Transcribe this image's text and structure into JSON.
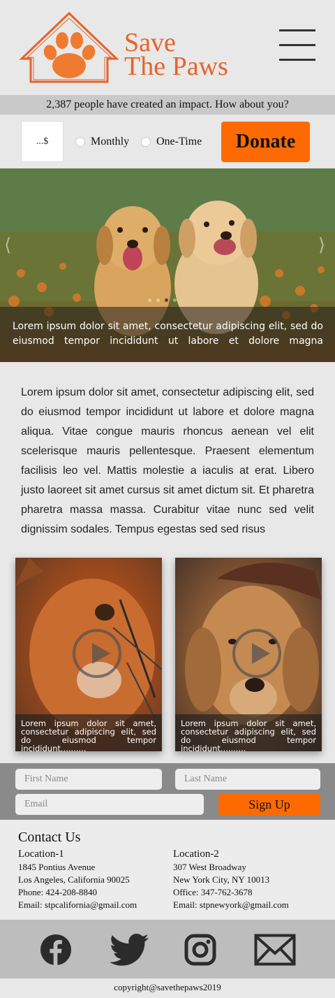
{
  "brand": {
    "line1": "Save",
    "line2": "The Paws"
  },
  "impact_text": "2,387 people have created an impact. How about you?",
  "donation": {
    "amount_placeholder": "...$",
    "options": [
      "Monthly",
      "One-Time"
    ],
    "button_label": "Donate"
  },
  "hero": {
    "caption": "Lorem ipsum dolor sit amet, consectetur adipiscing elit, sed do eiusmod tempor incididunt ut labore et dolore magna",
    "prev_arrow": "⟨",
    "next_arrow": "⟩",
    "slide_count": 4,
    "active_slide": 3
  },
  "intro_text": "Lorem ipsum dolor sit amet, consectetur adipiscing elit, sed do eiusmod tempor incididunt ut labore et dolore magna aliqua. Vitae congue mauris rhoncus aenean vel elit scelerisque mauris pellentesque. Praesent elementum facilisis leo vel. Mattis molestie a iaculis at erat. Libero justo laoreet sit amet cursus sit amet dictum sit. Et pharetra pharetra massa massa. Curabitur vitae nunc sed velit dignissim sodales. Tempus egestas sed sed risus",
  "videos": [
    {
      "caption": "Lorem ipsum dolor sit amet, consectetur adipiscing elit, sed do eiusmod tempor incididunt.........."
    },
    {
      "caption": "Lorem ipsum dolor sit amet, consectetur adipiscing elit, sed do eiusmod tempor incididunt.........."
    }
  ],
  "signup": {
    "first_name_placeholder": "First Name",
    "last_name_placeholder": "Last Name",
    "email_placeholder": "Email",
    "button_label": "Sign Up"
  },
  "contact": {
    "title": "Contact Us",
    "locations": [
      {
        "name": "Location-1",
        "street": "1845 Pontius Avenue",
        "city": "Los Angeles, California 90025",
        "phone": "Phone: 424-208-8840",
        "email": "Email: stpcalifornia@gmail.com"
      },
      {
        "name": "Location-2",
        "street": "307 West Broadway",
        "city": "New York City, NY 10013",
        "phone": "Office: 347-762-3678",
        "email": "Email: stpnewyork@gmail.com"
      }
    ]
  },
  "social_icons": [
    "facebook-icon",
    "twitter-icon",
    "instagram-icon",
    "mail-icon"
  ],
  "copyright": "copyright@savethepaws2019",
  "colors": {
    "accent": "#ff6a00",
    "brand": "#e8622a",
    "background": "#e8e8e8",
    "signup_bg": "#8a8a8a",
    "social_bg": "#bdbdbd"
  }
}
